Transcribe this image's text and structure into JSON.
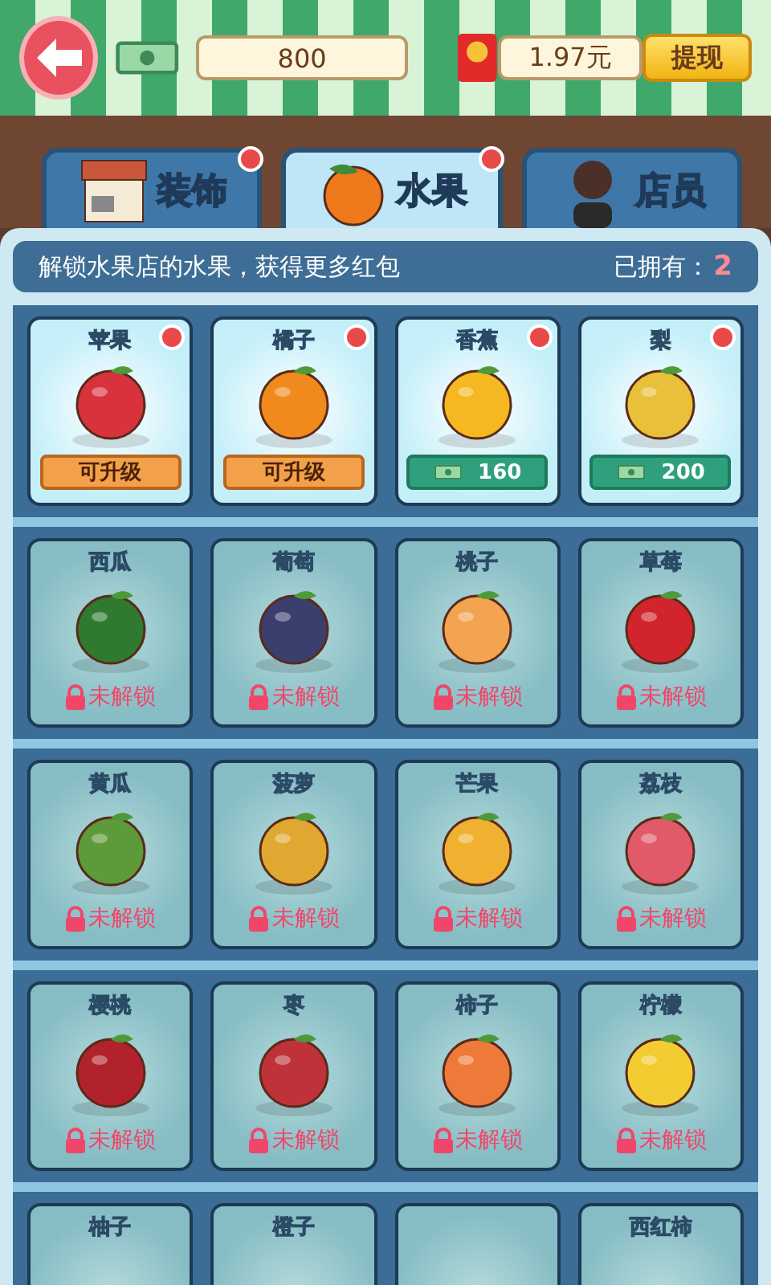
{
  "top_bar": {
    "coins": "800",
    "cash": "1.97元",
    "withdraw_button": "提现"
  },
  "tabs": [
    {
      "label": "装饰",
      "selected": false,
      "alert": true
    },
    {
      "label": "水果",
      "selected": true,
      "alert": true
    },
    {
      "label": "店员",
      "selected": false,
      "alert": false
    }
  ],
  "header": {
    "message": "解锁水果店的水果，获得更多红包",
    "owned_label": "已拥有：",
    "owned_count": "2"
  },
  "fruit_rows": [
    [
      {
        "name": "苹果",
        "kind": "upgrade",
        "action": "可升级",
        "alert": true,
        "color": "#d8333d"
      },
      {
        "name": "橘子",
        "kind": "upgrade",
        "action": "可升级",
        "alert": true,
        "color": "#f08a1c"
      },
      {
        "name": "香蕉",
        "kind": "price",
        "action": "160",
        "alert": true,
        "color": "#f5b820"
      },
      {
        "name": "梨",
        "kind": "price",
        "action": "200",
        "alert": true,
        "color": "#e8c03a"
      }
    ],
    [
      {
        "name": "西瓜",
        "kind": "locked",
        "action": "未解锁",
        "color": "#2f7a2e"
      },
      {
        "name": "葡萄",
        "kind": "locked",
        "action": "未解锁",
        "color": "#3b3f6e"
      },
      {
        "name": "桃子",
        "kind": "locked",
        "action": "未解锁",
        "color": "#f2a450"
      },
      {
        "name": "草莓",
        "kind": "locked",
        "action": "未解锁",
        "color": "#d2242c"
      }
    ],
    [
      {
        "name": "黄瓜",
        "kind": "locked",
        "action": "未解锁",
        "color": "#5c9a3a"
      },
      {
        "name": "菠萝",
        "kind": "locked",
        "action": "未解锁",
        "color": "#e0a830"
      },
      {
        "name": "芒果",
        "kind": "locked",
        "action": "未解锁",
        "color": "#f0b030"
      },
      {
        "name": "荔枝",
        "kind": "locked",
        "action": "未解锁",
        "color": "#e05a6a"
      }
    ],
    [
      {
        "name": "樱桃",
        "kind": "locked",
        "action": "未解锁",
        "color": "#b2222c"
      },
      {
        "name": "枣",
        "kind": "locked",
        "action": "未解锁",
        "color": "#c0323a"
      },
      {
        "name": "柿子",
        "kind": "locked",
        "action": "未解锁",
        "color": "#ee7a3a"
      },
      {
        "name": "柠檬",
        "kind": "locked",
        "action": "未解锁",
        "color": "#f2cc30"
      }
    ],
    [
      {
        "name": "柚子",
        "kind": "cut"
      },
      {
        "name": "橙子",
        "kind": "cut"
      },
      {
        "kind": "cut"
      },
      {
        "name": "西红柿",
        "kind": "cut"
      }
    ]
  ]
}
